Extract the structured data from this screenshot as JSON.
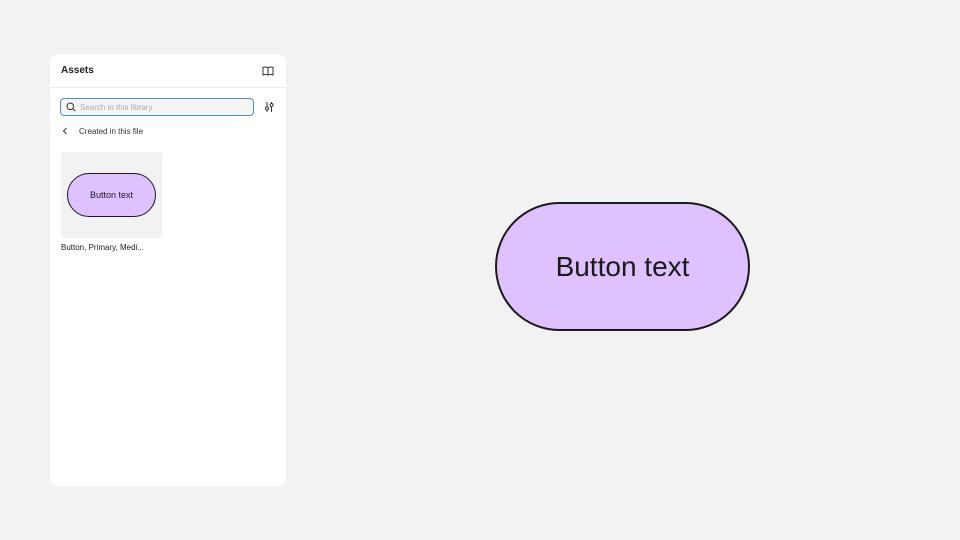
{
  "assets_panel": {
    "title": "Assets",
    "library_icon": "book-open-icon",
    "search": {
      "placeholder": "Search in this library",
      "value": "",
      "icon": "search-icon"
    },
    "filter_icon": "sliders-icon",
    "breadcrumb": {
      "back_icon": "chevron-left-icon",
      "label": "Created in this file"
    },
    "assets": [
      {
        "preview_label": "Button text",
        "name": "Button, Primary, Medi..."
      }
    ]
  },
  "canvas": {
    "button": {
      "label": "Button text"
    }
  },
  "colors": {
    "canvas_bg": "#f2f2f2",
    "panel_bg": "#ffffff",
    "button_fill": "#dfc1ff",
    "button_stroke": "#1a1a1a",
    "search_focus": "#4a90d9"
  }
}
